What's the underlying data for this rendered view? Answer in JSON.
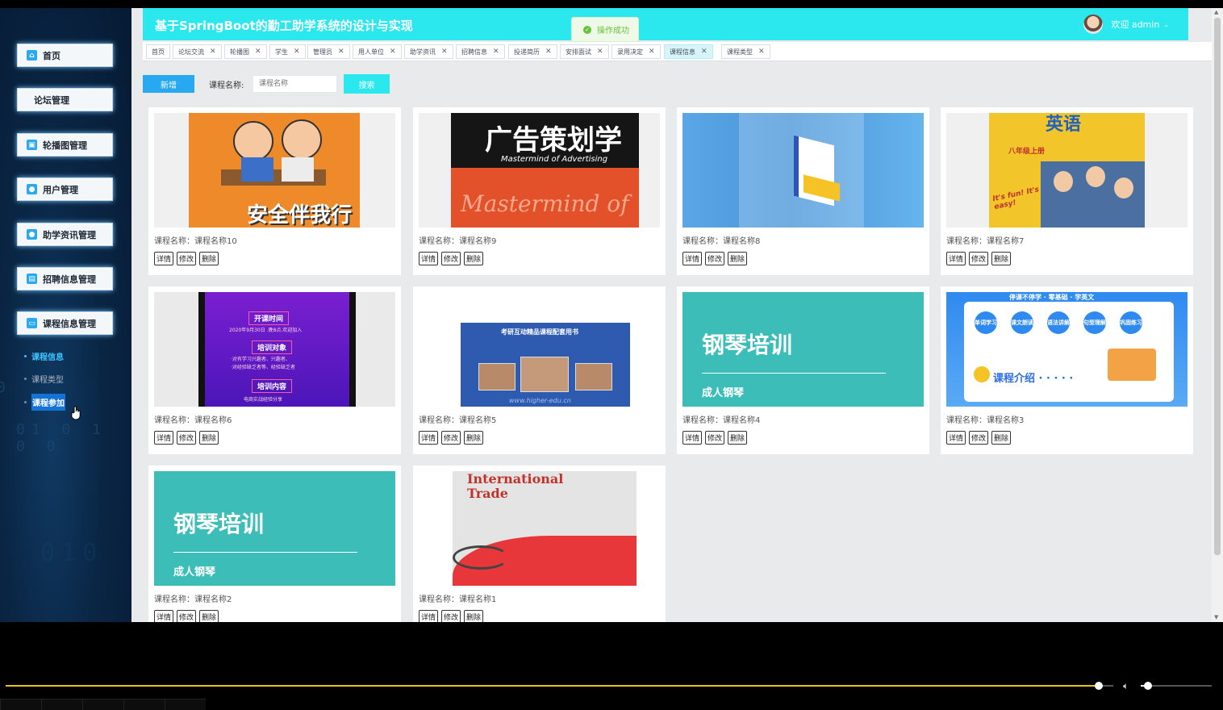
{
  "app_title": "基于SpringBoot的勤工助学系统的设计与实现",
  "user": {
    "greeting": "欢迎 admin",
    "dropdown_icon": "chevron-down-icon"
  },
  "toast": {
    "text": "操作成功",
    "color": "#67c23a"
  },
  "sidebar": {
    "items": [
      {
        "label": "首页",
        "icon": "home-icon"
      },
      {
        "label": "论坛管理",
        "icon": ""
      },
      {
        "label": "轮播图管理",
        "icon": "image-icon"
      },
      {
        "label": "用户管理",
        "icon": "user-icon"
      },
      {
        "label": "助学资讯管理",
        "icon": "info-icon"
      },
      {
        "label": "招聘信息管理",
        "icon": "briefcase-icon"
      },
      {
        "label": "课程信息管理",
        "icon": "book-icon"
      }
    ],
    "submenu": [
      {
        "label": "课程信息",
        "state": "active"
      },
      {
        "label": "课程类型",
        "state": "normal"
      },
      {
        "label": "课程参加",
        "state": "hover"
      }
    ]
  },
  "tabs": [
    {
      "label": "首页",
      "closable": false
    },
    {
      "label": "论坛交流",
      "closable": true
    },
    {
      "label": "轮播图",
      "closable": true
    },
    {
      "label": "学生",
      "closable": true
    },
    {
      "label": "管理员",
      "closable": true
    },
    {
      "label": "用人单位",
      "closable": true
    },
    {
      "label": "助学资讯",
      "closable": true
    },
    {
      "label": "招聘信息",
      "closable": true
    },
    {
      "label": "投递简历",
      "closable": true
    },
    {
      "label": "安排面试",
      "closable": true
    },
    {
      "label": "录用决定",
      "closable": true
    },
    {
      "label": "课程信息",
      "closable": true,
      "active": true
    },
    {
      "label": "课程类型",
      "closable": true
    }
  ],
  "toolbar": {
    "add_label": "新增",
    "name_label": "课程名称:",
    "name_placeholder": "课程名称",
    "search_label": "搜索"
  },
  "card_actions": {
    "detail": "详情",
    "edit": "修改",
    "delete": "删除"
  },
  "cards": [
    {
      "caption": "课程名称：课程名称10",
      "image_text": [
        "安全伴我行"
      ]
    },
    {
      "caption": "课程名称：课程名称9",
      "image_text": [
        "广告策划学",
        "Mastermind of Advertising",
        "Mastermind of"
      ]
    },
    {
      "caption": "课程名称：课程名称8",
      "image_text": []
    },
    {
      "caption": "课程名称：课程名称7",
      "image_text": [
        "英语",
        "八年级上册",
        "It's fun! It's easy!"
      ]
    },
    {
      "caption": "课程名称：课程名称6",
      "image_text": [
        "开课时间",
        "2020年9月30日 .晚8点.欢迎加入",
        "培训对象",
        "·对有学习兴趣者、兴趣者、",
        "·对经验缺乏者等、经验缺乏者",
        "培训内容",
        "电商实战经验分享"
      ]
    },
    {
      "caption": "课程名称：课程名称5",
      "image_text": [
        "考研互动精品课程配套用书",
        "www.higher-edu.cn"
      ]
    },
    {
      "caption": "课程名称：课程名称4",
      "image_text": [
        "钢琴培训",
        "成人钢琴"
      ]
    },
    {
      "caption": "课程名称：课程名称3",
      "image_text": [
        "停课不停学 · 零基础 · 学英文",
        "单词学习",
        "课文朗读",
        "语法讲解",
        "句型理解",
        "巩固练习",
        "课程介绍 · · · · ·"
      ]
    },
    {
      "caption": "课程名称：课程名称2",
      "image_text": [
        "钢琴培训",
        "成人钢琴"
      ]
    },
    {
      "caption": "课程名称：课程名称1",
      "image_text": [
        "International",
        "Trade"
      ]
    }
  ],
  "colors": {
    "header": "#2ae8ee",
    "sidebar": "#0a2645",
    "primary": "#27a8f0",
    "seek": "#e8c21a"
  },
  "player": {
    "progress": 0.904,
    "volume": 0.1
  }
}
